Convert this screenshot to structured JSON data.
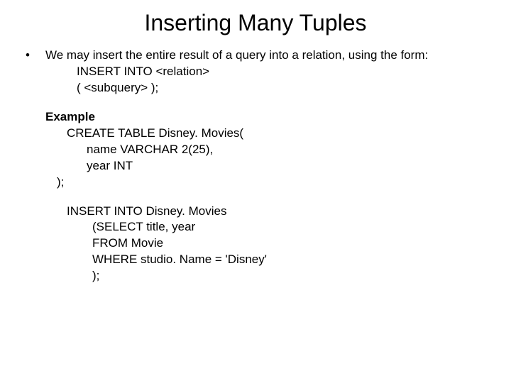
{
  "title": "Inserting Many Tuples",
  "bullet": {
    "intro": "We may insert the entire result of a query into a relation, using the form:",
    "syntax1": "INSERT INTO <relation>",
    "syntax2": "( <subquery> );"
  },
  "example": {
    "heading": "Example",
    "create1": "CREATE TABLE Disney. Movies(",
    "create2": "name VARCHAR 2(25),",
    "create3": "year INT",
    "create4": ");",
    "insert1": "INSERT INTO Disney. Movies",
    "insert2": "(SELECT title, year",
    "insert3": " FROM Movie",
    "insert4": " WHERE studio. Name = 'Disney'",
    "insert5": " );"
  }
}
